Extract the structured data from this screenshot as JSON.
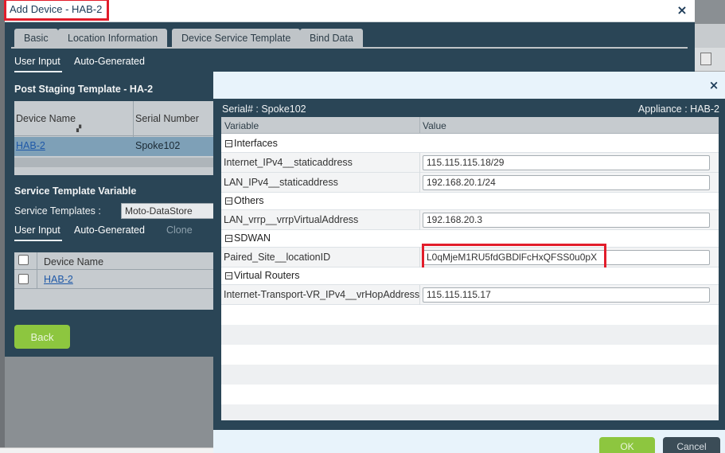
{
  "dialog": {
    "title": "Add Device - HAB-2",
    "close": "×",
    "tabs": [
      "Basic",
      "Location Information",
      "Device Service Template",
      "Bind Data"
    ],
    "subtabs": [
      "User Input",
      "Auto-Generated"
    ],
    "post_staging": {
      "title": "Post Staging Template - HA-2",
      "columns": [
        "Device Name",
        "Serial Number"
      ],
      "row": {
        "device": "HAB-2",
        "serial": "Spoke102"
      }
    },
    "service_template": {
      "title": "Service Template Variable",
      "label": "Service Templates :",
      "selected": "Moto-DataStore",
      "subtabs": [
        "User Input",
        "Auto-Generated",
        "Clone"
      ],
      "column": "Device Name",
      "row_device": "HAB-2"
    },
    "back_label": "Back"
  },
  "bind_modal": {
    "close": "×",
    "serial": "Serial# : Spoke102",
    "appliance": "Appliance : HAB-2",
    "columns": {
      "variable": "Variable",
      "value": "Value"
    },
    "groups": {
      "interfaces": {
        "label": "Interfaces",
        "rows": [
          {
            "var": "Internet_IPv4__staticaddress",
            "val": "115.115.115.18/29"
          },
          {
            "var": "LAN_IPv4__staticaddress",
            "val": "192.168.20.1/24"
          }
        ]
      },
      "others": {
        "label": "Others",
        "rows": [
          {
            "var": "LAN_vrrp__vrrpVirtualAddress",
            "val": "192.168.20.3"
          }
        ]
      },
      "sdwan": {
        "label": "SDWAN",
        "rows": [
          {
            "var": "Paired_Site__locationID",
            "val": "L0qMjeM1RU5fdGBDlFcHxQFSS0u0pX"
          }
        ]
      },
      "virtual_routers": {
        "label": "Virtual Routers",
        "rows": [
          {
            "var": "Internet-Transport-VR_IPv4__vrHopAddress",
            "val": "115.115.115.17"
          }
        ]
      }
    },
    "ok_label": "OK",
    "cancel_label": "Cancel"
  },
  "colors": {
    "accent_green": "#8dc63f",
    "highlight_red": "#e21d2b",
    "panel_dark": "#2a4556"
  }
}
